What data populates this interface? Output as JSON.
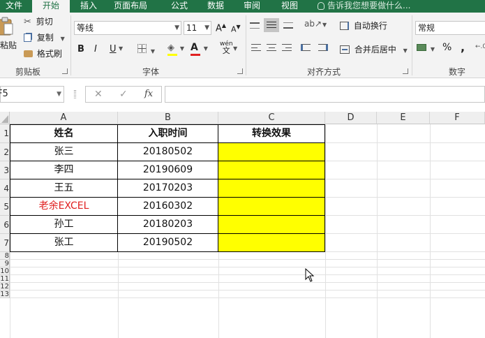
{
  "tabs": [
    {
      "label": "文件",
      "active": false
    },
    {
      "label": "开始",
      "active": true
    },
    {
      "label": "插入",
      "active": false
    },
    {
      "label": "页面布局",
      "active": false
    },
    {
      "label": "公式",
      "active": false
    },
    {
      "label": "数据",
      "active": false
    },
    {
      "label": "审阅",
      "active": false
    },
    {
      "label": "视图",
      "active": false
    }
  ],
  "tell_me": "告诉我您想要做什么...",
  "clipboard": {
    "paste": "粘贴",
    "cut": "剪切",
    "copy": "复制",
    "format_painter": "格式刷",
    "group": "剪贴板"
  },
  "font": {
    "name": "等线",
    "size": "11",
    "bold": "B",
    "italic": "I",
    "underline": "U",
    "grow": "A",
    "shrink": "A",
    "color_letter": "A",
    "phonetic_top": "wén",
    "phonetic_bottom": "文",
    "group": "字体",
    "fill_color": "#ffff00",
    "font_color": "#e02020"
  },
  "alignment": {
    "wrap": "自动换行",
    "merge": "合并后居中",
    "group": "对齐方式"
  },
  "number": {
    "format": "常规",
    "percent": "%",
    "comma": ",",
    "group": "数字"
  },
  "formula_bar": {
    "name_box": "F5",
    "cancel": "✕",
    "enter": "✓",
    "fx": "fx",
    "content": ""
  },
  "columns": [
    "A",
    "B",
    "C",
    "D",
    "E",
    "F"
  ],
  "rows": [
    "1",
    "2",
    "3",
    "4",
    "5",
    "6",
    "7",
    "8",
    "9",
    "10",
    "11",
    "12",
    "13"
  ],
  "table": {
    "headers": [
      "姓名",
      "入职时间",
      "转换效果"
    ],
    "rows": [
      {
        "name": "张三",
        "date": "20180502",
        "result": ""
      },
      {
        "name": "李四",
        "date": "20190609",
        "result": ""
      },
      {
        "name": "王五",
        "date": "20170203",
        "result": ""
      },
      {
        "name": "老余EXCEL",
        "date": "20160302",
        "result": "",
        "highlight": true
      },
      {
        "name": "孙工",
        "date": "20180203",
        "result": ""
      },
      {
        "name": "张工",
        "date": "20190502",
        "result": ""
      }
    ],
    "result_fill": "#ffff00",
    "highlight_color": "#e02020"
  }
}
